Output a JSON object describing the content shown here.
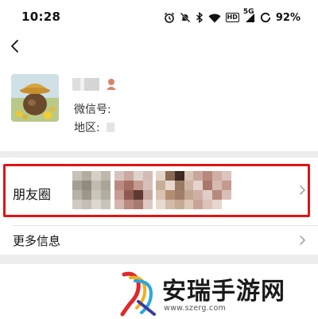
{
  "status_bar": {
    "time": "10:28",
    "network_label": "5G",
    "hd_label": "HD",
    "battery_percent": "92%",
    "icons": [
      "alarm-icon",
      "mute-icon",
      "bluetooth-icon",
      "wifi-icon",
      "hd-icon",
      "signal-icon",
      "battery-icon"
    ]
  },
  "nav": {
    "back_icon": "chevron-left-icon"
  },
  "profile": {
    "wechat_id_label": "微信号:",
    "region_label": "地区:"
  },
  "moments": {
    "label": "朋友圈",
    "highlight_color": "#e01414"
  },
  "more_info": {
    "label": "更多信息"
  },
  "watermark": {
    "title": "安瑞手游网",
    "url": "www.szerg.com"
  },
  "colors": {
    "background": "#ffffff",
    "separator": "#ededed",
    "text": "#111111"
  }
}
